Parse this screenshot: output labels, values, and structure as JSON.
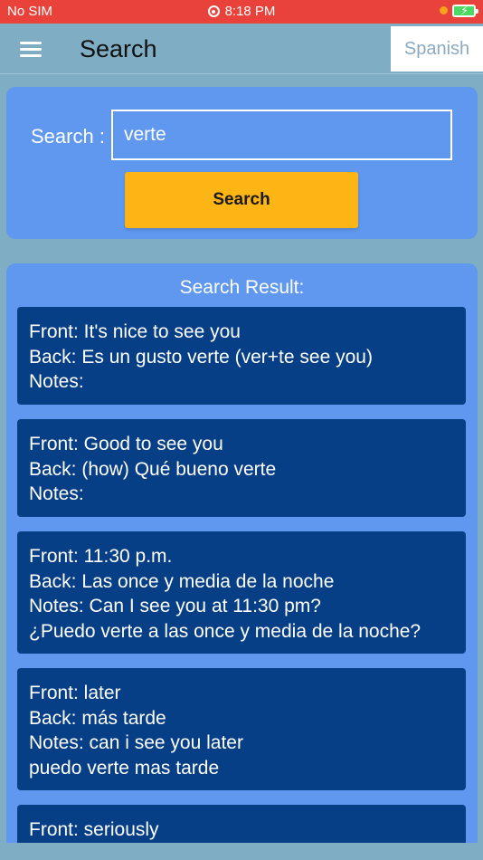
{
  "status_bar": {
    "carrier": "No SIM",
    "time": "8:18 PM"
  },
  "header": {
    "title": "Search",
    "language_button": "Spanish",
    "menu_icon": "hamburger-menu-icon"
  },
  "search": {
    "label": "Search :",
    "input_value": "verte",
    "button_label": "Search"
  },
  "results": {
    "title": "Search Result:",
    "items": [
      {
        "front": "Front: It's nice to see you",
        "back": "Back: Es un gusto verte (ver+te see you)",
        "notes": "Notes:",
        "notes_extra": ""
      },
      {
        "front": "Front: Good to see you",
        "back": "Back: (how) Qué bueno verte",
        "notes": "Notes:",
        "notes_extra": ""
      },
      {
        "front": "Front: 11:30 p.m.",
        "back": "Back: Las once y media de la noche",
        "notes": "Notes: Can I see you at 11:30 pm?",
        "notes_extra": "¿Puedo verte a las once y media de la noche?"
      },
      {
        "front": "Front: later",
        "back": "Back: más tarde",
        "notes": "Notes: can i see you later",
        "notes_extra": "puedo verte mas tarde"
      },
      {
        "front": "Front: seriously",
        "back": "",
        "notes": "",
        "notes_extra": ""
      }
    ]
  },
  "colors": {
    "status_bar": "#E8423A",
    "background": "#7FAEC4",
    "panel": "#5F98EE",
    "card": "#073F86",
    "search_button": "#FDB515"
  }
}
